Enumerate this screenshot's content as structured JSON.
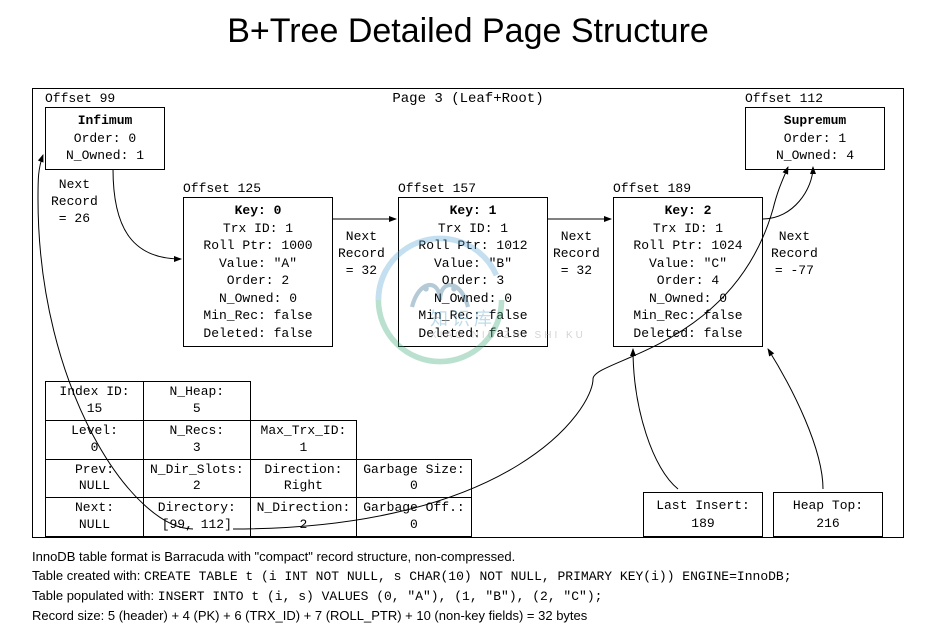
{
  "title": "B+Tree Detailed Page Structure",
  "page_label": "Page 3 (Leaf+Root)",
  "infimum": {
    "offset_label": "Offset 99",
    "name": "Infimum",
    "order": "Order: 0",
    "n_owned": "N_Owned: 1",
    "next_label": "Next\nRecord\n= 26"
  },
  "supremum": {
    "offset_label": "Offset 112",
    "name": "Supremum",
    "order": "Order: 1",
    "n_owned": "N_Owned: 4"
  },
  "records": [
    {
      "offset_label": "Offset 125",
      "key": "Key: 0",
      "trx": "Trx ID: 1",
      "roll": "Roll Ptr: 1000",
      "value": "Value: \"A\"",
      "order": "Order: 2",
      "n_owned": "N_Owned: 0",
      "min_rec": "Min_Rec: false",
      "deleted": "Deleted: false",
      "next_label": "Next\nRecord\n= 32"
    },
    {
      "offset_label": "Offset 157",
      "key": "Key: 1",
      "trx": "Trx ID: 1",
      "roll": "Roll Ptr: 1012",
      "value": "Value: \"B\"",
      "order": "Order: 3",
      "n_owned": "N_Owned: 0",
      "min_rec": "Min_Rec: false",
      "deleted": "Deleted: false",
      "next_label": "Next\nRecord\n= 32"
    },
    {
      "offset_label": "Offset 189",
      "key": "Key: 2",
      "trx": "Trx ID: 1",
      "roll": "Roll Ptr: 1024",
      "value": "Value: \"C\"",
      "order": "Order: 4",
      "n_owned": "N_Owned: 0",
      "min_rec": "Min_Rec: false",
      "deleted": "Deleted: false",
      "next_label": "Next\nRecord\n= -77"
    }
  ],
  "stats": {
    "rows": [
      [
        "Index ID:\n15",
        "N_Heap:\n5",
        "",
        ""
      ],
      [
        "Level:\n0",
        "N_Recs:\n3",
        "Max_Trx_ID:\n1",
        ""
      ],
      [
        "Prev:\nNULL",
        "N_Dir_Slots:\n2",
        "Direction:\nRight",
        "Garbage Size:\n0"
      ],
      [
        "Next:\nNULL",
        "Directory:\n[99, 112]",
        "N_Direction:\n2",
        "Garbage Off.:\n0"
      ]
    ]
  },
  "last_insert": "Last Insert:\n189",
  "heap_top": "Heap Top:\n216",
  "footer": {
    "l1": "InnoDB table format is Barracuda with \"compact\" record structure, non-compressed.",
    "l2a": "Table created with: ",
    "l2b": "CREATE TABLE t (i INT NOT NULL, s CHAR(10) NOT NULL, PRIMARY KEY(i)) ENGINE=InnoDB;",
    "l3a": "Table populated with: ",
    "l3b": "INSERT INTO t (i, s) VALUES (0, \"A\"), (1, \"B\"), (2, \"C\");",
    "l4": "Record size: 5 (header) + 4 (PK) + 6 (TRX_ID) + 7 (ROLL_PTR) + 10 (non-key fields) = 32 bytes"
  },
  "watermark": {
    "main": "知识库",
    "sub": "XIAO NIU ZHI SHI KU"
  }
}
